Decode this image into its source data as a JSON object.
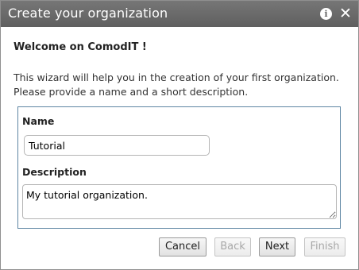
{
  "dialog": {
    "title": "Create your organization",
    "icons": {
      "info": "info-icon",
      "close": "close-icon"
    }
  },
  "content": {
    "welcome": "Welcome on ComodIT !",
    "intro_lines": [
      "This wizard will help you in the creation of your first organization.",
      "Please provide a name and a short description."
    ]
  },
  "form": {
    "name_label": "Name",
    "name_value": "Tutorial",
    "description_label": "Description",
    "description_value": "My tutorial organization."
  },
  "buttons": {
    "cancel": "Cancel",
    "back": "Back",
    "next": "Next",
    "finish": "Finish"
  },
  "colors": {
    "titlebar": "#6b6b6b",
    "fieldset_border": "#5e86a3",
    "disabled_text": "#a8a8a8"
  }
}
